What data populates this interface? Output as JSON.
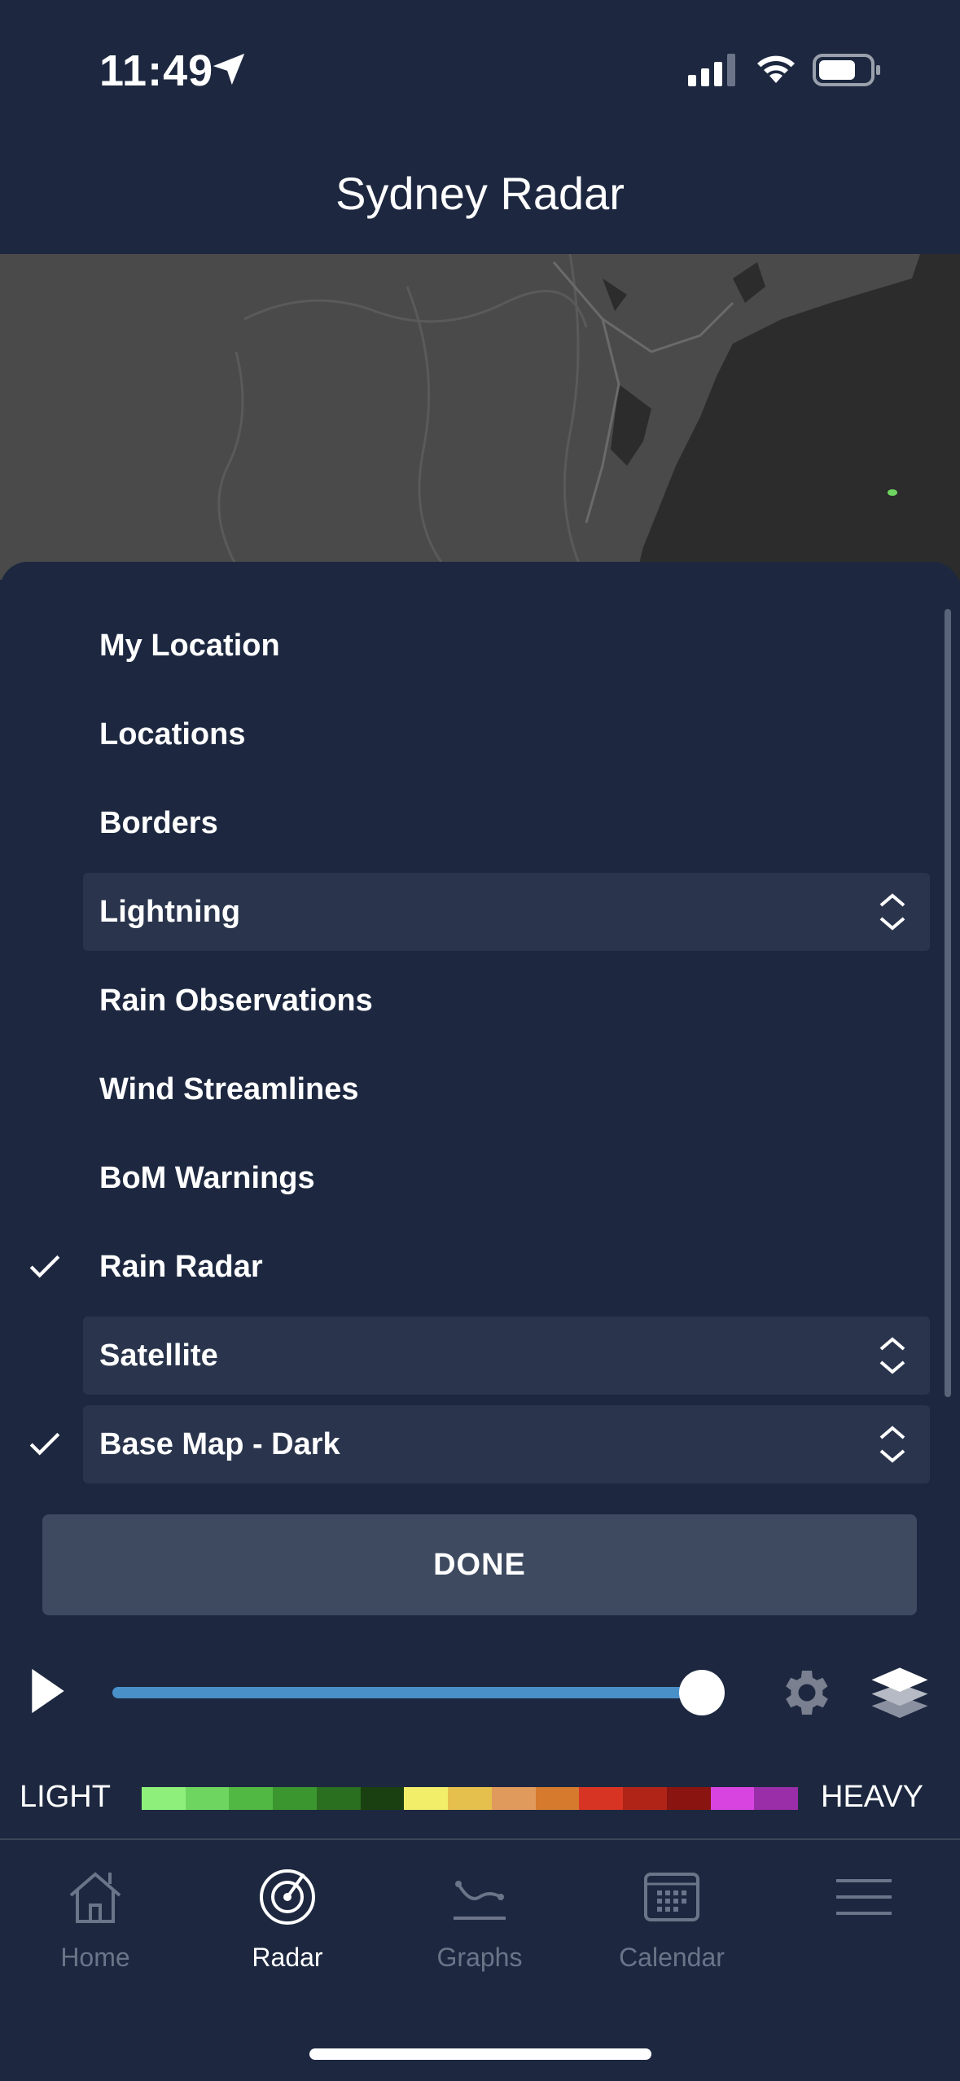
{
  "status_bar": {
    "time": "11:49",
    "icons": [
      "location-arrow-icon",
      "cellular-signal-icon",
      "wifi-icon",
      "battery-icon"
    ]
  },
  "header": {
    "title": "Sydney Radar"
  },
  "layers": {
    "items": [
      {
        "label": "My Location",
        "checked": false,
        "expandable": false
      },
      {
        "label": "Locations",
        "checked": false,
        "expandable": false
      },
      {
        "label": "Borders",
        "checked": false,
        "expandable": false
      },
      {
        "label": "Lightning",
        "checked": false,
        "expandable": true
      },
      {
        "label": "Rain Observations",
        "checked": false,
        "expandable": false
      },
      {
        "label": "Wind Streamlines",
        "checked": false,
        "expandable": false
      },
      {
        "label": "BoM Warnings",
        "checked": false,
        "expandable": false
      },
      {
        "label": "Rain Radar",
        "checked": true,
        "expandable": false
      },
      {
        "label": "Satellite",
        "checked": false,
        "expandable": true
      },
      {
        "label": "Base Map - Dark",
        "checked": true,
        "expandable": true
      }
    ],
    "done_label": "DONE"
  },
  "playback": {
    "progress": 0.97
  },
  "legend": {
    "light_label": "LIGHT",
    "heavy_label": "HEAVY",
    "colors": [
      "#8ef07a",
      "#6ed660",
      "#52b844",
      "#3c962f",
      "#2a6e1f",
      "#1a3f10",
      "#f2ee6a",
      "#e6c04c",
      "#e09a5c",
      "#d67a2e",
      "#d83424",
      "#b02418",
      "#8a1410",
      "#d844e0",
      "#9a2ea8"
    ]
  },
  "tabs": [
    {
      "label": "Home",
      "icon": "home-icon",
      "active": false
    },
    {
      "label": "Radar",
      "icon": "radar-icon",
      "active": true
    },
    {
      "label": "Graphs",
      "icon": "graph-icon",
      "active": false
    },
    {
      "label": "Calendar",
      "icon": "calendar-icon",
      "active": false
    },
    {
      "label": "",
      "icon": "menu-icon",
      "active": false
    }
  ],
  "colors": {
    "background": "#1d2840",
    "row_highlight": "#2a354d",
    "done_button": "#3d4a60",
    "timeline_fill": "#4a90c8",
    "inactive_tab": "#6b7488"
  }
}
